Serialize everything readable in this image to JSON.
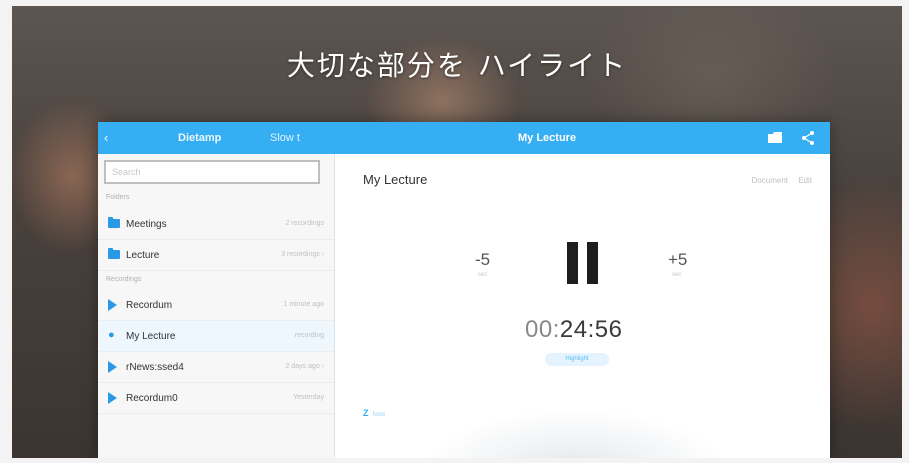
{
  "headline": "大切な部分を ハイライト",
  "nav": {
    "back_label": "‹",
    "left_title": "Dietamp",
    "left_action": "Slow t",
    "title": "My Lecture",
    "folder_icon": "folder-icon",
    "share_icon": "share-icon"
  },
  "sidebar": {
    "search_placeholder": "Search",
    "section_folders": "Folders",
    "folders": [
      {
        "name": "Meetings",
        "meta": "2 recordings",
        "icon": "folder-icon"
      },
      {
        "name": "Lecture",
        "meta": "3 recordings ›",
        "icon": "folder-icon"
      }
    ],
    "section_recordings": "Recordings",
    "recordings": [
      {
        "name": "Recordum",
        "meta": "1 minute ago",
        "icon": "play-icon"
      },
      {
        "name": "My Lecture",
        "meta": "recording",
        "icon": "person-icon"
      },
      {
        "name": "rNews:ssed4",
        "meta": "2 days ago ›",
        "icon": "play-icon"
      },
      {
        "name": "Recordum0",
        "meta": "Yesterday",
        "icon": "play-icon"
      }
    ]
  },
  "main": {
    "title": "My Lecture",
    "tools": "Document Edit",
    "skip_back": "-5",
    "skip_back_sub": "sec",
    "skip_fwd": "+5",
    "skip_fwd_sub": "sec",
    "timer_prefix": "00:",
    "timer_main": "24:56",
    "pill_label": "Highlight",
    "marker_label": "Z",
    "marker_text": "Note"
  },
  "colors": {
    "accent": "#36aef4",
    "folder": "#2a9ae6",
    "highlight": "#f4d21f"
  }
}
